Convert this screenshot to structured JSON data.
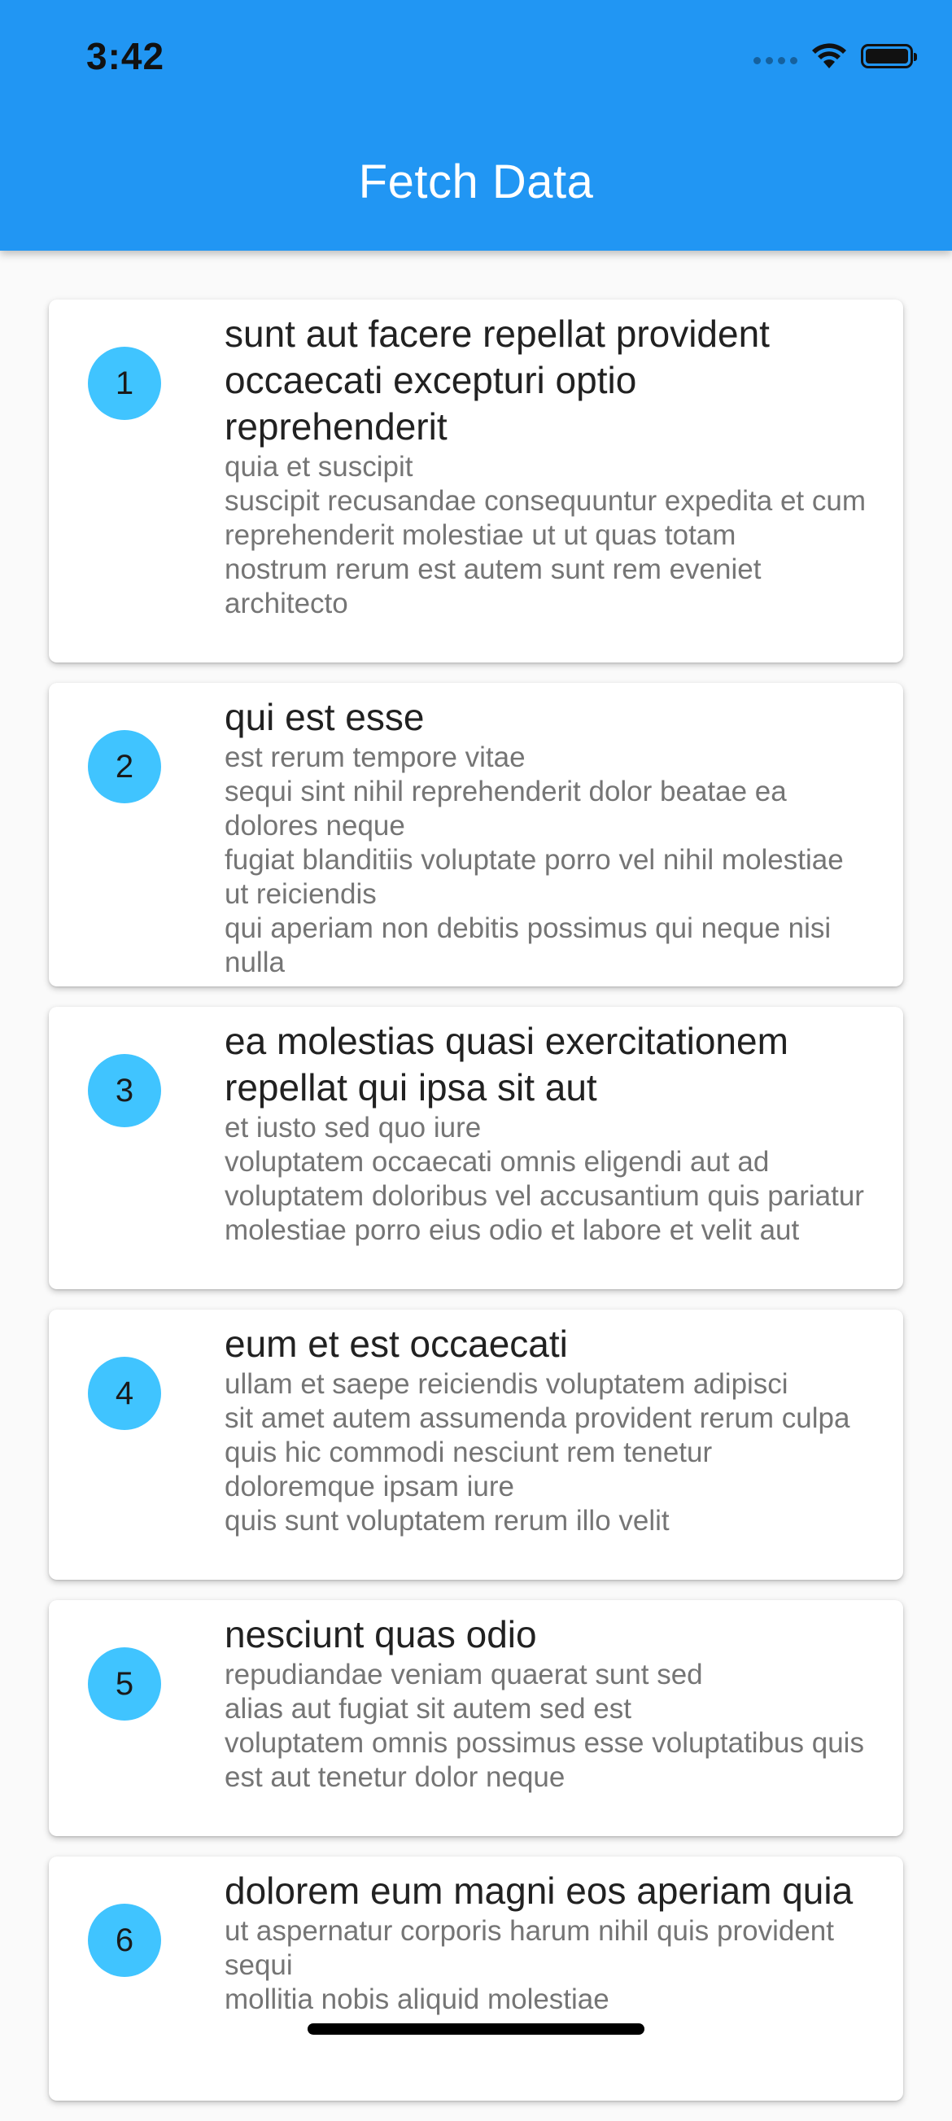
{
  "status_bar": {
    "time": "3:42"
  },
  "app_bar": {
    "title": "Fetch Data",
    "color": "#2196f3"
  },
  "items": [
    {
      "id": "1",
      "title": "sunt aut facere repellat provident occaecati excepturi optio reprehenderit",
      "body": "quia et suscipit\nsuscipit recusandae consequuntur expedita et cum\nreprehenderit molestiae ut ut quas totam\nnostrum rerum est autem sunt rem eveniet architecto"
    },
    {
      "id": "2",
      "title": "qui est esse",
      "body": "est rerum tempore vitae\nsequi sint nihil reprehenderit dolor beatae ea dolores neque\nfugiat blanditiis voluptate porro vel nihil molestiae ut reiciendis\nqui aperiam non debitis possimus qui neque nisi nulla"
    },
    {
      "id": "3",
      "title": "ea molestias quasi exercitationem repellat qui ipsa sit aut",
      "body": "et iusto sed quo iure\nvoluptatem occaecati omnis eligendi aut ad\nvoluptatem doloribus vel accusantium quis pariatur\nmolestiae porro eius odio et labore et velit aut"
    },
    {
      "id": "4",
      "title": "eum et est occaecati",
      "body": "ullam et saepe reiciendis voluptatem adipisci\nsit amet autem assumenda provident rerum culpa\nquis hic commodi nesciunt rem tenetur doloremque ipsam iure\nquis sunt voluptatem rerum illo velit"
    },
    {
      "id": "5",
      "title": "nesciunt quas odio",
      "body": "repudiandae veniam quaerat sunt sed\nalias aut fugiat sit autem sed est\nvoluptatem omnis possimus esse voluptatibus quis\nest aut tenetur dolor neque"
    },
    {
      "id": "6",
      "title": "dolorem eum magni eos aperiam quia",
      "body": "ut aspernatur corporis harum nihil quis provident sequi\nmollitia nobis aliquid molestiae"
    }
  ]
}
